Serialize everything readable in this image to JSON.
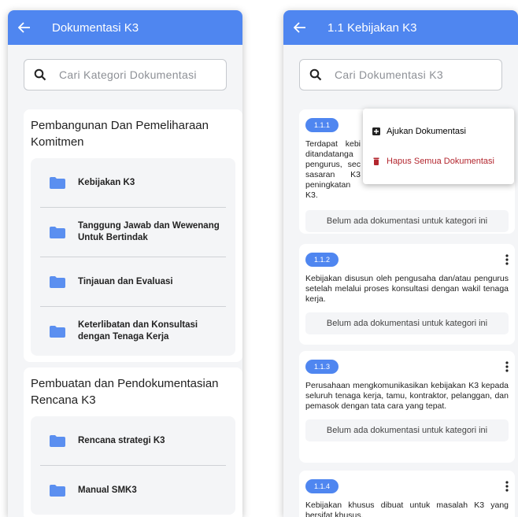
{
  "left": {
    "title": "Dokumentasi K3",
    "search_placeholder": "Cari Kategori Dokumentasi",
    "groups": [
      {
        "title": "Pembangunan Dan Pemeliharaan Komitmen",
        "items": [
          {
            "label": "Kebijakan K3"
          },
          {
            "label": "Tanggung Jawab dan Wewenang Untuk Bertindak"
          },
          {
            "label": "Tinjauan dan Evaluasi"
          },
          {
            "label": "Keterlibatan dan Konsultasi dengan Tenaga Kerja"
          }
        ]
      },
      {
        "title": "Pembuatan dan Pendokumentasian Rencana K3",
        "items": [
          {
            "label": "Rencana strategi K3"
          },
          {
            "label": "Manual SMK3"
          }
        ]
      }
    ]
  },
  "right": {
    "title": "1.1 Kebijakan K3",
    "search_placeholder": "Cari Dokumentasi K3",
    "menu": {
      "submit": "Ajukan Dokumentasi",
      "delete_all": "Hapus Semua Dokumentasi"
    },
    "empty_text": "Belum ada dokumentasi untuk kategori ini",
    "entries": [
      {
        "code": "1.1.1",
        "desc": "Terdapat kebi ditandatanga pengurus, sec sasaran K3 peningkatan K3."
      },
      {
        "code": "1.1.2",
        "desc": "Kebijakan disusun oleh pengusaha dan/atau pengurus setelah melalui proses konsultasi dengan wakil tenaga kerja."
      },
      {
        "code": "1.1.3",
        "desc": "Perusahaan mengkomunikasikan kebijakan K3 kepada seluruh tenaga kerja, tamu, kontraktor, pelanggan, dan pemasok dengan tata cara yang tepat."
      },
      {
        "code": "1.1.4",
        "desc": "Kebijakan khusus dibuat untuk masalah K3 yang bersifat khusus."
      }
    ]
  },
  "colors": {
    "appbar": "#4f86f0",
    "folder": "#4f86f0",
    "danger": "#b3262e"
  }
}
